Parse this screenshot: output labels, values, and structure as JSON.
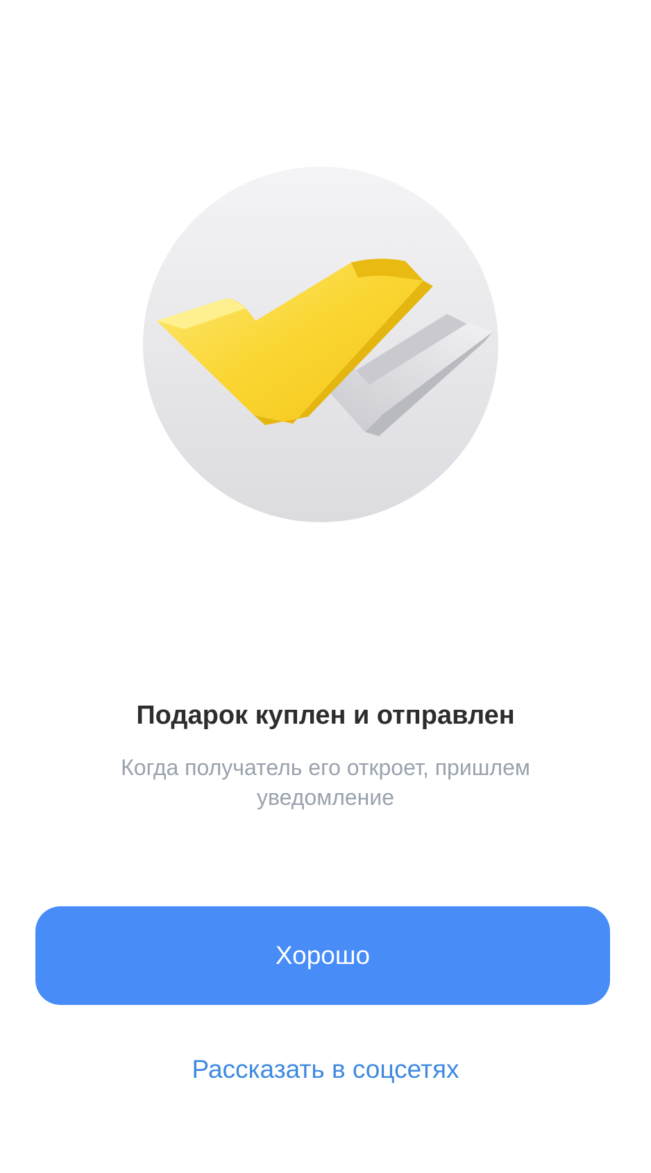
{
  "dialog": {
    "illustration_icon": "double-checkmark-icon",
    "title": "Подарок куплен и отправлен",
    "subtitle": "Когда получатель его откроет, пришлем уведомление",
    "ok_button_label": "Хорошо",
    "share_link_label": "Рассказать в соцсетях"
  },
  "colors": {
    "accent": "#478cf7",
    "link": "#3f8ae0",
    "title_text": "#2c2d2e",
    "secondary_text": "#99a2ad",
    "check_yellow": "#f7d21e",
    "check_gray": "#d6d6da",
    "circle_background": "#e8e8eb"
  }
}
